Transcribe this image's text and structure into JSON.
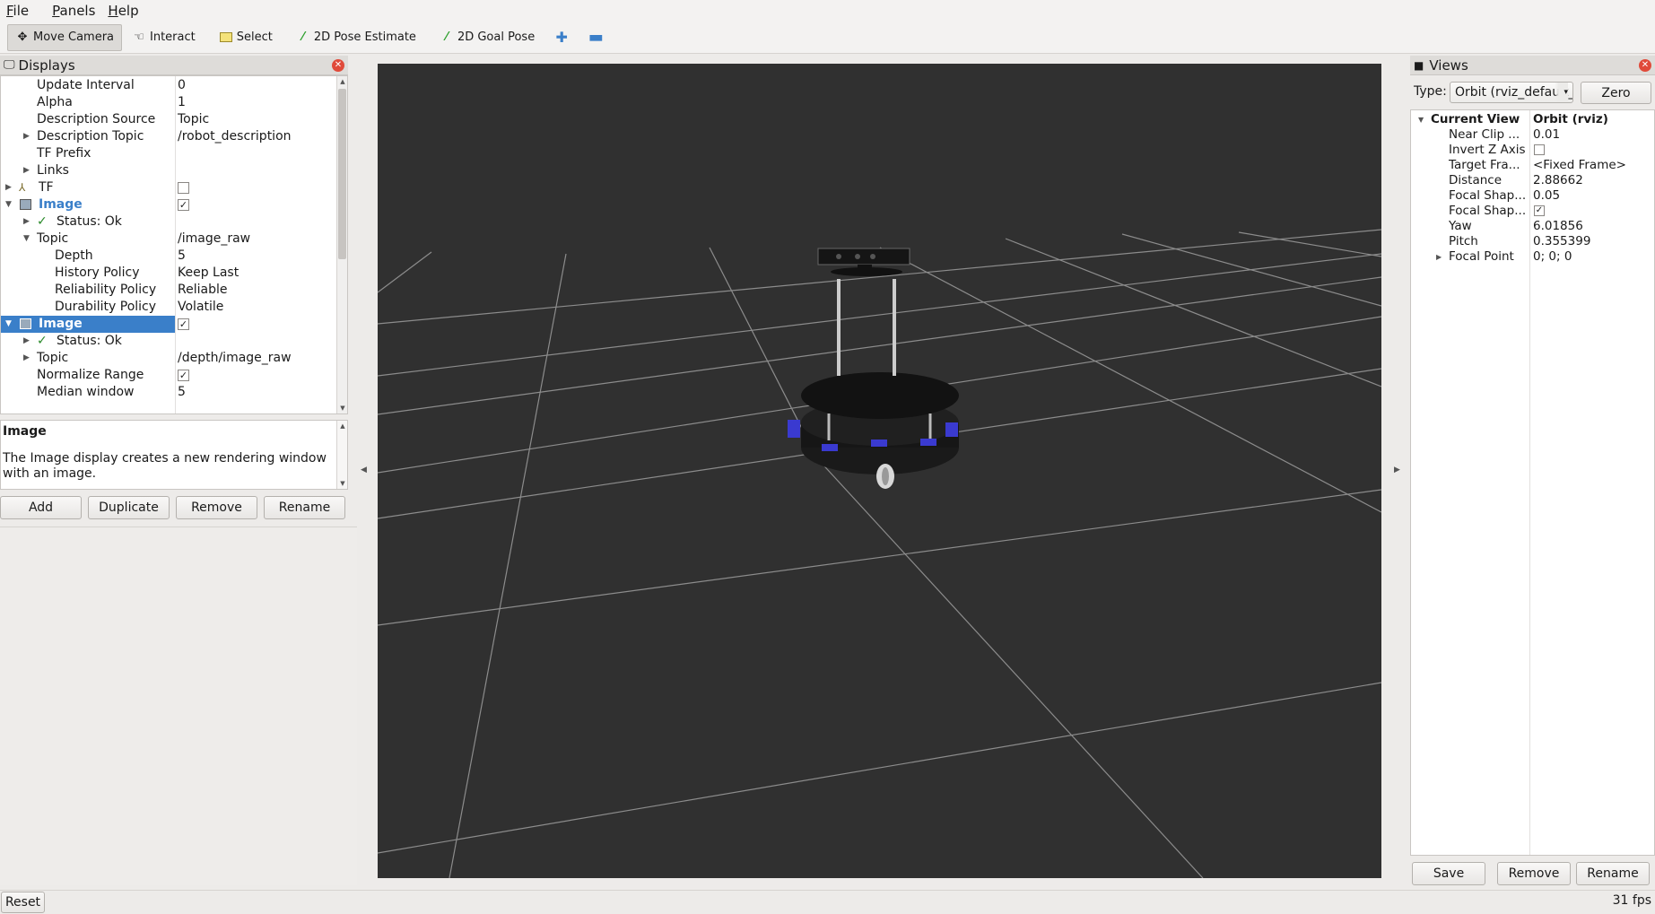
{
  "menu": [
    "File",
    "Panels",
    "Help"
  ],
  "menu_mnemonics": [
    "F",
    "P",
    "H"
  ],
  "menu_rest": [
    "ile",
    "anels",
    "elp"
  ],
  "toolbar": {
    "move_camera": "Move Camera",
    "interact": "Interact",
    "select": "Select",
    "pose_estimate": "2D Pose Estimate",
    "goal_pose": "2D Goal Pose"
  },
  "displays": {
    "title": "Displays",
    "rows": [
      {
        "name": "Update Interval",
        "value": "0"
      },
      {
        "name": "Alpha",
        "value": "1"
      },
      {
        "name": "Description Source",
        "value": "Topic"
      },
      {
        "name": "Description Topic",
        "value": "/robot_description"
      },
      {
        "name": "TF Prefix",
        "value": ""
      },
      {
        "name": "Links",
        "value": ""
      },
      {
        "name": "TF",
        "value": ""
      },
      {
        "name": "Image",
        "value": ""
      },
      {
        "name": "Status: Ok",
        "value": ""
      },
      {
        "name": "Topic",
        "value": "/image_raw"
      },
      {
        "name": "Depth",
        "value": "5"
      },
      {
        "name": "History Policy",
        "value": "Keep Last"
      },
      {
        "name": "Reliability Policy",
        "value": "Reliable"
      },
      {
        "name": "Durability Policy",
        "value": "Volatile"
      },
      {
        "name": "Image",
        "value": ""
      },
      {
        "name": "Status: Ok",
        "value": ""
      },
      {
        "name": "Topic",
        "value": "/depth/image_raw"
      },
      {
        "name": "Normalize Range",
        "value": ""
      },
      {
        "name": "Median window",
        "value": "5"
      }
    ],
    "desc_title": "Image",
    "desc_text": "The Image display creates a new rendering window with an image.",
    "buttons": [
      "Add",
      "Duplicate",
      "Remove",
      "Rename"
    ]
  },
  "views": {
    "title": "Views",
    "type_label": "Type:",
    "type_value": "Orbit (rviz_default_plugins)",
    "zero": "Zero",
    "current_view": "Current View",
    "current_view_value": "Orbit (rviz)",
    "rows": [
      {
        "name": "Near Clip ...",
        "value": "0.01"
      },
      {
        "name": "Invert Z Axis",
        "value": ""
      },
      {
        "name": "Target Fra...",
        "value": "<Fixed Frame>"
      },
      {
        "name": "Distance",
        "value": "2.88662"
      },
      {
        "name": "Focal Shap...",
        "value": "0.05"
      },
      {
        "name": "Focal Shap...",
        "value": ""
      },
      {
        "name": "Yaw",
        "value": "6.01856"
      },
      {
        "name": "Pitch",
        "value": "0.355399"
      },
      {
        "name": "Focal Point",
        "value": "0; 0; 0"
      }
    ],
    "buttons": [
      "Save",
      "Remove",
      "Rename"
    ]
  },
  "status": {
    "reset": "Reset",
    "fps": "31 fps"
  },
  "colors": {
    "accent": "#3a7fc9",
    "viewport": "#303030",
    "grid": "#8c8c8c"
  }
}
